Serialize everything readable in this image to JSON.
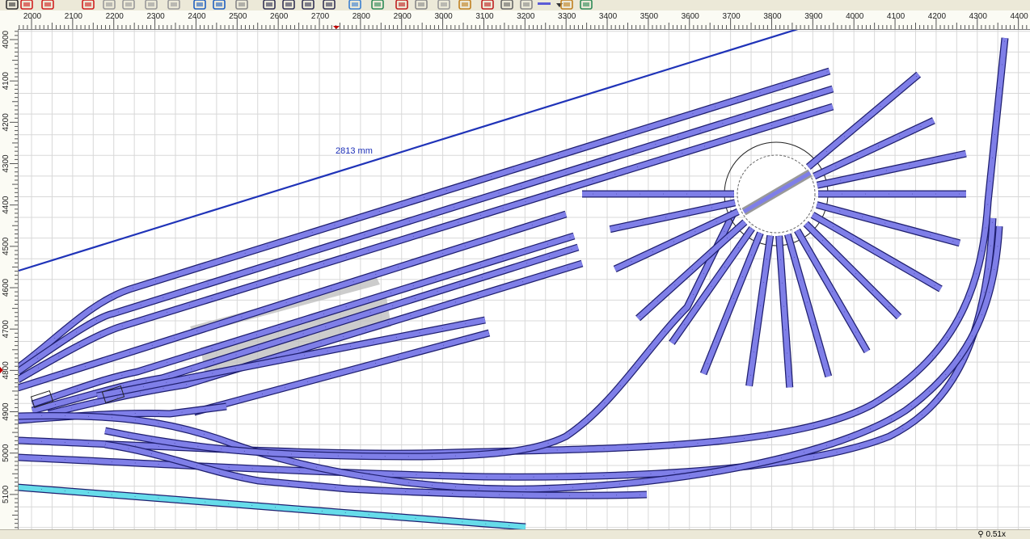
{
  "toolbar": {
    "buttons": [
      {
        "name": "zoom-fit-icon"
      },
      {
        "name": "undo-icon"
      },
      {
        "name": "redo-icon"
      },
      {
        "name": "redo-all-icon"
      },
      {
        "name": "cut-icon"
      },
      {
        "name": "copy-icon"
      },
      {
        "name": "paste-icon"
      },
      {
        "name": "delete-icon"
      },
      {
        "name": "rotate-icon"
      },
      {
        "name": "select-icon"
      },
      {
        "name": "measure-icon"
      },
      {
        "name": "zoom-in-icon"
      },
      {
        "name": "zoom-out-icon"
      },
      {
        "name": "zoom-window-icon"
      },
      {
        "name": "table-icon"
      },
      {
        "name": "image-icon"
      },
      {
        "name": "layers-icon"
      },
      {
        "name": "signal-icon"
      },
      {
        "name": "track-icon"
      },
      {
        "name": "switch-icon"
      },
      {
        "name": "bridge-icon"
      },
      {
        "name": "stop-icon"
      },
      {
        "name": "block-icon"
      },
      {
        "name": "grid-icon"
      },
      {
        "name": "line-style-icon"
      },
      {
        "name": "dropdown-arrow-icon"
      },
      {
        "name": "tools-icon"
      },
      {
        "name": "view-3d-icon"
      }
    ]
  },
  "ruler": {
    "unit": "mm",
    "top_labels": [
      "2000",
      "2100",
      "2200",
      "2300",
      "2400",
      "2500",
      "2600",
      "2700",
      "2800",
      "2900",
      "3000",
      "3100",
      "3200",
      "3300",
      "3400",
      "3500",
      "3600",
      "3700",
      "3800",
      "3900",
      "4000",
      "4100",
      "4200",
      "4300",
      "4400"
    ],
    "left_labels": [
      "4000",
      "4100",
      "4200",
      "4300",
      "4400",
      "4500",
      "4600",
      "4700",
      "4800",
      "4900",
      "5000",
      "5100"
    ]
  },
  "layout": {
    "measurement_label": "2813 mm"
  },
  "status": {
    "zoom": "0.51x"
  },
  "colors": {
    "track_fill": "#7f7fe8",
    "track_edge": "#1f1f6f",
    "track_fill_cyan": "#66dcea",
    "measure_line": "#1f33b8",
    "platform": "#bfbfbf",
    "grid": "#d8d8d8"
  }
}
